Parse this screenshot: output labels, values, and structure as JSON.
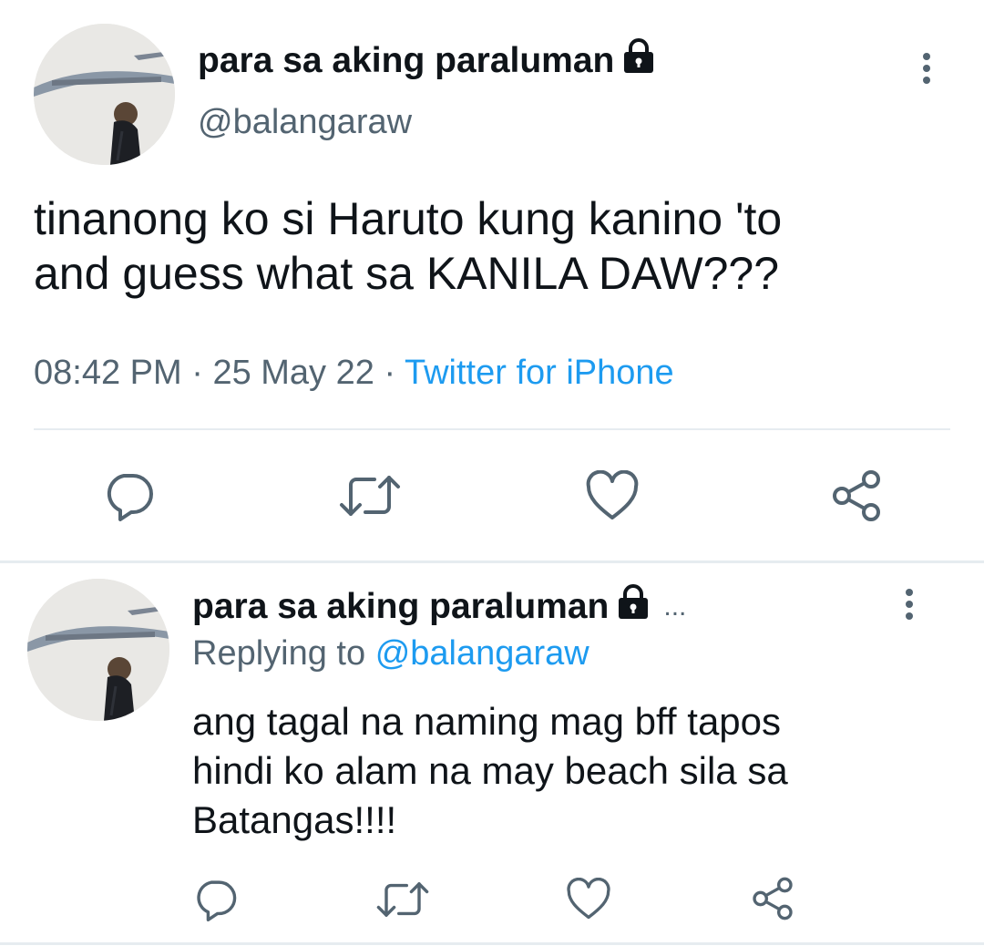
{
  "main_tweet": {
    "display_name": "para sa aking paraluman",
    "handle": "@balangaraw",
    "text_line1": "tinanong ko si Haruto kung kanino 'to",
    "text_line2": "and guess what sa KANILA DAW???",
    "time": "08:42 PM",
    "date": "25 May 22",
    "sep": "·",
    "source": "Twitter for iPhone"
  },
  "reply_tweet": {
    "display_name": "para sa aking paraluman",
    "ellipsis": "...",
    "replying_prefix": "Replying to",
    "replying_handle": "@balangaraw",
    "text_line1": "ang tagal na naming mag bff tapos",
    "text_line2": "hindi ko alam na may beach sila sa",
    "text_line3": "Batangas!!!!"
  },
  "icons": {
    "lock": "lock-icon",
    "more": "more-vertical-icon",
    "reply": "reply-bubble-icon",
    "retweet": "retweet-icon",
    "like": "heart-icon",
    "share": "share-icon"
  },
  "colors": {
    "text": "#0f1419",
    "secondary": "#536471",
    "link": "#1d9bf0",
    "divider": "#e6ecf0"
  }
}
